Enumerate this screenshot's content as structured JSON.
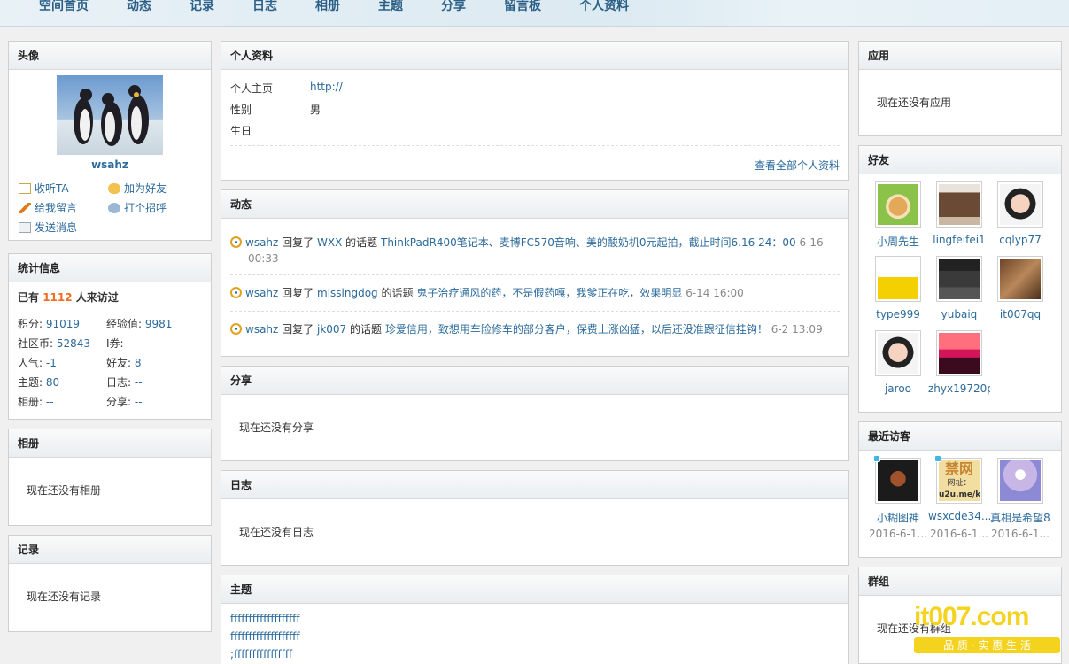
{
  "nav": {
    "items": [
      "空间首页",
      "动态",
      "记录",
      "日志",
      "相册",
      "主题",
      "分享",
      "留言板",
      "个人资料"
    ]
  },
  "avatar_box": {
    "title": "头像",
    "username": "wsahz",
    "actions": [
      "收听TA",
      "加为好友",
      "给我留言",
      "打个招呼",
      "发送消息"
    ]
  },
  "stats_box": {
    "title": "统计信息",
    "visits_prefix": "已有",
    "visits_count": "1112",
    "visits_suffix": "人来访过",
    "rows": [
      {
        "label": "积分:",
        "value": "91019"
      },
      {
        "label": "经验值:",
        "value": "9981"
      },
      {
        "label": "社区币:",
        "value": "52843"
      },
      {
        "label": "I券:",
        "value": "--"
      },
      {
        "label": "人气:",
        "value": "-1"
      },
      {
        "label": "好友:",
        "value": "8"
      },
      {
        "label": "主题:",
        "value": "80"
      },
      {
        "label": "日志:",
        "value": "--"
      },
      {
        "label": "相册:",
        "value": "--"
      },
      {
        "label": "分享:",
        "value": "--"
      }
    ]
  },
  "album_box": {
    "title": "相册",
    "empty": "现在还没有相册"
  },
  "record_box": {
    "title": "记录",
    "empty": "现在还没有记录"
  },
  "profile_box": {
    "title": "个人资料",
    "fields": [
      {
        "label": "个人主页",
        "value": "http://"
      },
      {
        "label": "性别",
        "value": "男"
      },
      {
        "label": "生日",
        "value": ""
      }
    ],
    "more_link": "查看全部个人资料"
  },
  "feed_box": {
    "title": "动态",
    "items": [
      {
        "user": "wsahz",
        "verb": "回复了",
        "target": "WXX",
        "mid": "的话题",
        "topic": "ThinkPadR400笔记本、麦博FC570音响、美的酸奶机0元起拍，截止时间6.16 24：00",
        "time": "6-16",
        "time2": "00:33"
      },
      {
        "user": "wsahz",
        "verb": "回复了",
        "target": "missingdog",
        "mid": "的话题",
        "topic": "鬼子治疗通风的药，不是假药嘎，我爹正在吃，效果明显",
        "time": "6-14 16:00"
      },
      {
        "user": "wsahz",
        "verb": "回复了",
        "target": "jk007",
        "mid": "的话题",
        "topic": "珍爱信用，致想用车险修车的部分客户，保费上涨凶猛，以后还没准跟征信挂钩！",
        "time": "6-2 13:09"
      }
    ]
  },
  "share_box": {
    "title": "分享",
    "empty": "现在还没有分享"
  },
  "blog_box": {
    "title": "日志",
    "empty": "现在还没有日志"
  },
  "thread_box": {
    "title": "主题",
    "items": [
      "fffffffffffffffffff",
      "fffffffffffffffffff",
      ";ffffffffffffffff"
    ]
  },
  "apps_box": {
    "title": "应用",
    "empty": "现在还没有应用"
  },
  "friends_box": {
    "title": "好友",
    "friends": [
      "小周先生",
      "lingfeifei1",
      "cqlyp77",
      "type999",
      "yubaiq",
      "it007qq",
      "jaroo",
      "zhyx19720p"
    ]
  },
  "visitors_box": {
    "title": "最近访客",
    "visitors": [
      {
        "name": "小糊图神",
        "date": "2016-6-1..."
      },
      {
        "name": "wsxcde34...",
        "date": "2016-6-1..."
      },
      {
        "name": "真相是希望8",
        "date": "2016-6-1..."
      }
    ],
    "ad_text_1": "禁网",
    "ad_text_2": "网址：",
    "ad_text_3": "u2u.me/k"
  },
  "group_box": {
    "title": "群组",
    "empty": "现在还没有群组"
  },
  "watermark": {
    "text": "it007.com",
    "slogan": "品 质 · 实 惠 生 活"
  }
}
